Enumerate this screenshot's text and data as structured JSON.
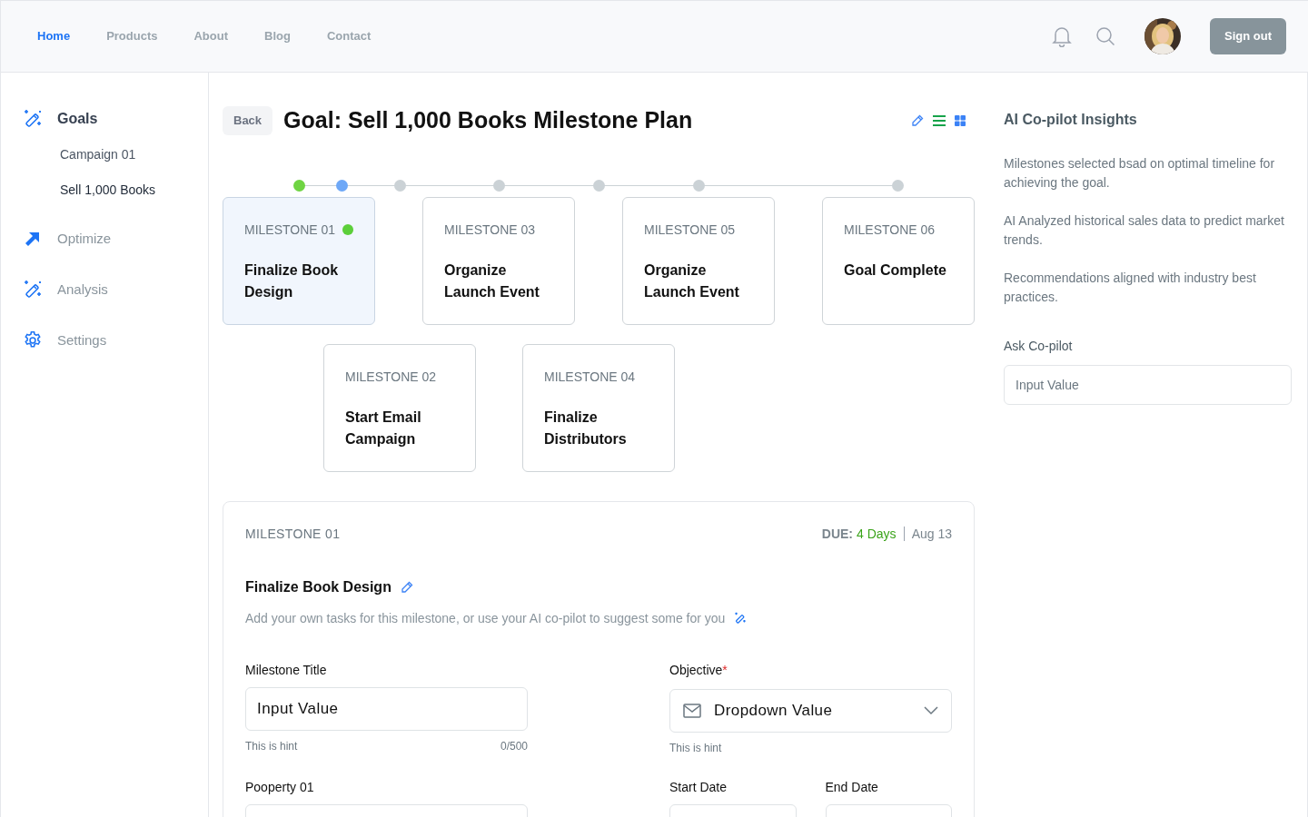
{
  "nav": [
    {
      "label": "Home",
      "selected": true
    },
    {
      "label": "Products",
      "selected": false
    },
    {
      "label": "About",
      "selected": false
    },
    {
      "label": "Blog",
      "selected": false
    },
    {
      "label": "Contact",
      "selected": false
    }
  ],
  "sign_out": "Sign out",
  "sidebar": {
    "items": [
      {
        "label": "Goals",
        "kind": "wand",
        "selected": true,
        "children": [
          {
            "label": "Campaign 01",
            "selected": false
          },
          {
            "label": "Sell 1,000 Books",
            "selected": true
          }
        ]
      },
      {
        "label": "Optimize",
        "kind": "arrow",
        "selected": false
      },
      {
        "label": "Analysis",
        "kind": "wand",
        "selected": false
      },
      {
        "label": "Settings",
        "kind": "gear",
        "selected": false
      }
    ]
  },
  "back": "Back",
  "title": "Goal: Sell 1,000 Books Milestone Plan",
  "timeline": [
    {
      "color": "#6fd443"
    },
    {
      "color": "#6ea8f7"
    },
    {
      "color": "#cbd2d6"
    },
    {
      "color": "#cbd2d6"
    },
    {
      "color": "#cbd2d6"
    },
    {
      "color": "#cbd2d6"
    },
    {
      "color": "#cbd2d6"
    }
  ],
  "milestone_rows": [
    [
      {
        "label": "MILESTONE 01",
        "title": "Finalize Book Design",
        "selected": true,
        "done": true
      },
      {
        "label": "MILESTONE 03",
        "title": "Organize Launch Event",
        "selected": false,
        "done": false
      },
      {
        "label": "MILESTONE 05",
        "title": "Organize Launch Event",
        "selected": false,
        "done": false
      },
      {
        "label": "MILESTONE 06",
        "title": "Goal Complete",
        "selected": false,
        "done": false
      }
    ],
    [
      {
        "label": "MILESTONE 02",
        "title": "Start Email Campaign",
        "selected": false,
        "done": false
      },
      {
        "label": "MILESTONE 04",
        "title": "Finalize Distributors",
        "selected": false,
        "done": false
      }
    ]
  ],
  "detail": {
    "label": "MILESTONE 01",
    "due_label": "DUE:",
    "due_value": "4 Days",
    "due_date": "Aug 13",
    "title": "Finalize Book Design",
    "description": "Add your own tasks for this milestone, or use your AI co-pilot to suggest some for you",
    "form_rows": [
      {
        "left": {
          "label": "Milestone Title",
          "value": "Input Value",
          "hint": "This is hint",
          "counter": "0/500"
        },
        "right": [
          {
            "kind": "dropdown",
            "label": "Objective",
            "required_mark": "*",
            "value": "Dropdown Value",
            "hint": "This is hint"
          }
        ]
      },
      {
        "left": {
          "label": "Pooperty 01"
        },
        "right": [
          {
            "kind": "date",
            "label": "Start Date"
          },
          {
            "kind": "date",
            "label": "End Date"
          }
        ]
      }
    ]
  },
  "insights": {
    "title": "AI Co-pilot Insights",
    "paragraphs": [
      "Milestones selected bsad on optimal timeline for achieving the goal.",
      "AI Analyzed historical sales data to predict market trends.",
      "Recommendations aligned with industry best practices."
    ],
    "ask_label": "Ask Co-pilot",
    "ask_placeholder": "Input Value"
  }
}
